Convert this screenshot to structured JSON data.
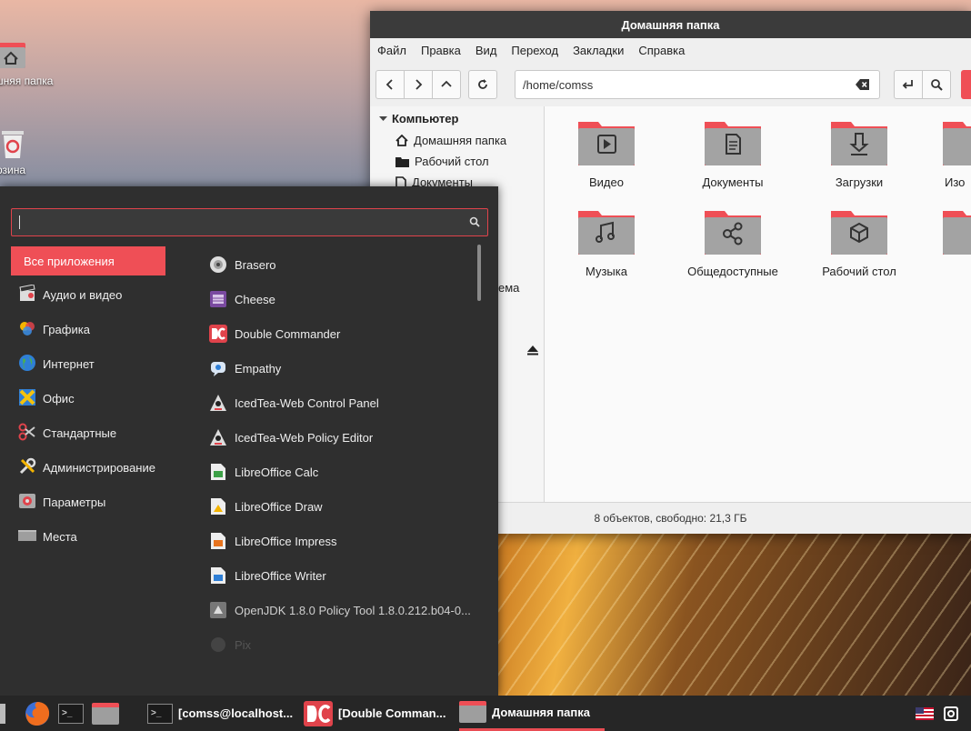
{
  "desktop": {
    "icons": [
      {
        "label": "шняя папка",
        "icon": "home-folder-icon"
      },
      {
        "label": "рзина",
        "icon": "trash-icon"
      }
    ]
  },
  "file_manager": {
    "title": "Домашняя папка",
    "menu": [
      "Файл",
      "Правка",
      "Вид",
      "Переход",
      "Закладки",
      "Справка"
    ],
    "address": "/home/comss",
    "sidebar": {
      "header": "Компьютер",
      "items": [
        "Домашняя папка",
        "Рабочий стол",
        "Документы"
      ],
      "partial": "ема"
    },
    "items": [
      {
        "label": "Видео",
        "icon": "video-folder-icon"
      },
      {
        "label": "Документы",
        "icon": "documents-folder-icon"
      },
      {
        "label": "Загрузки",
        "icon": "downloads-folder-icon"
      },
      {
        "label": "Изо",
        "icon": "pictures-folder-icon"
      },
      {
        "label": "Музыка",
        "icon": "music-folder-icon"
      },
      {
        "label": "Общедоступные",
        "icon": "public-folder-icon"
      },
      {
        "label": "Рабочий стол",
        "icon": "desktop-folder-icon"
      },
      {
        "label": "",
        "icon": "folder-icon"
      }
    ],
    "status": "8 объектов, свободно: 21,3 ГБ",
    "colors": {
      "accent": "#ef4f56",
      "folder_body": "#9e9e9e"
    }
  },
  "app_menu": {
    "search_value": "",
    "categories": [
      {
        "label": "Все приложения",
        "icon": "all-apps-icon",
        "active": true
      },
      {
        "label": "Аудио и видео",
        "icon": "multimedia-icon"
      },
      {
        "label": "Графика",
        "icon": "graphics-icon"
      },
      {
        "label": "Интернет",
        "icon": "internet-globe-icon"
      },
      {
        "label": "Офис",
        "icon": "office-icon"
      },
      {
        "label": "Стандартные",
        "icon": "accessories-scissors-icon"
      },
      {
        "label": "Администрирование",
        "icon": "administration-tools-icon"
      },
      {
        "label": "Параметры",
        "icon": "settings-icon"
      },
      {
        "label": "Места",
        "icon": "places-folder-icon"
      }
    ],
    "apps": [
      {
        "label": "Brasero",
        "icon": "brasero-disc-icon"
      },
      {
        "label": "Cheese",
        "icon": "cheese-camera-icon"
      },
      {
        "label": "Double Commander",
        "icon": "double-commander-icon"
      },
      {
        "label": "Empathy",
        "icon": "empathy-chat-icon"
      },
      {
        "label": "IcedTea-Web Control Panel",
        "icon": "icedtea-java-icon"
      },
      {
        "label": "IcedTea-Web Policy Editor",
        "icon": "icedtea-java-icon"
      },
      {
        "label": "LibreOffice Calc",
        "icon": "libreoffice-calc-icon"
      },
      {
        "label": "LibreOffice Draw",
        "icon": "libreoffice-draw-icon"
      },
      {
        "label": "LibreOffice Impress",
        "icon": "libreoffice-impress-icon"
      },
      {
        "label": "LibreOffice Writer",
        "icon": "libreoffice-writer-icon"
      },
      {
        "label": "OpenJDK 1.8.0 Policy Tool 1.8.0.212.b04-0...",
        "icon": "openjdk-icon"
      },
      {
        "label": "Pix",
        "icon": "pix-image-icon"
      }
    ]
  },
  "taskbar": {
    "items": [
      {
        "label": "[comss@localhost...",
        "icon": "terminal-icon"
      },
      {
        "label": "[Double Comman...",
        "icon": "double-commander-icon"
      },
      {
        "label": "Домашняя папка",
        "icon": "folder-icon",
        "active": true
      }
    ],
    "tray": [
      "us-flag-icon",
      "clipboard-icon"
    ]
  }
}
